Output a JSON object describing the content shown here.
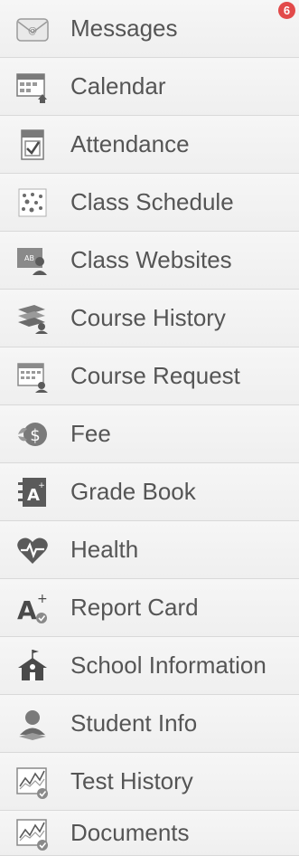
{
  "menu": {
    "items": [
      {
        "label": "Messages",
        "icon": "envelope-icon",
        "badge": "6"
      },
      {
        "label": "Calendar",
        "icon": "calendar-icon"
      },
      {
        "label": "Attendance",
        "icon": "attendance-checkbox-icon"
      },
      {
        "label": "Class Schedule",
        "icon": "class-schedule-icon"
      },
      {
        "label": "Class Websites",
        "icon": "class-websites-icon"
      },
      {
        "label": "Course History",
        "icon": "course-history-icon"
      },
      {
        "label": "Course Request",
        "icon": "course-request-icon"
      },
      {
        "label": "Fee",
        "icon": "fee-dollar-icon"
      },
      {
        "label": "Grade Book",
        "icon": "grade-book-icon"
      },
      {
        "label": "Health",
        "icon": "health-heart-icon"
      },
      {
        "label": "Report Card",
        "icon": "report-card-icon"
      },
      {
        "label": "School Information",
        "icon": "school-house-icon"
      },
      {
        "label": "Student Info",
        "icon": "student-info-icon"
      },
      {
        "label": "Test History",
        "icon": "test-history-chart-icon"
      },
      {
        "label": "Documents",
        "icon": "documents-chart-icon"
      }
    ]
  },
  "colors": {
    "icon_gray": "#6b6b6b",
    "text": "#555555",
    "badge": "#e24a4a",
    "background": "#f2f2f2"
  }
}
